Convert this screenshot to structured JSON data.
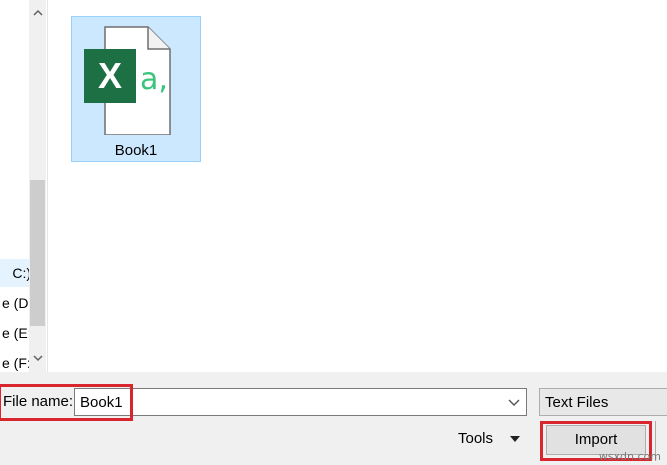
{
  "nav": {
    "drives": [
      {
        "label": "C:)",
        "selected": true
      },
      {
        "label": "e (D:)",
        "selected": false
      },
      {
        "label": "e (E:)",
        "selected": false
      },
      {
        "label": "e (F:)",
        "selected": false
      }
    ]
  },
  "files": [
    {
      "name": "Book1",
      "icon": "excel-csv-icon",
      "icon_letter": "X",
      "icon_badge": "a,",
      "selected": true
    }
  ],
  "bottom": {
    "file_name_label": "File name:",
    "file_name_value": "Book1",
    "file_type_value": "Text Files",
    "tools_label": "Tools",
    "import_label": "Import"
  },
  "colors": {
    "selection": "#cce8ff",
    "excel_green": "#1d7044",
    "badge_green": "#3cc47c",
    "highlight_red": "#d8262f"
  },
  "watermark": "wsxdn.com"
}
